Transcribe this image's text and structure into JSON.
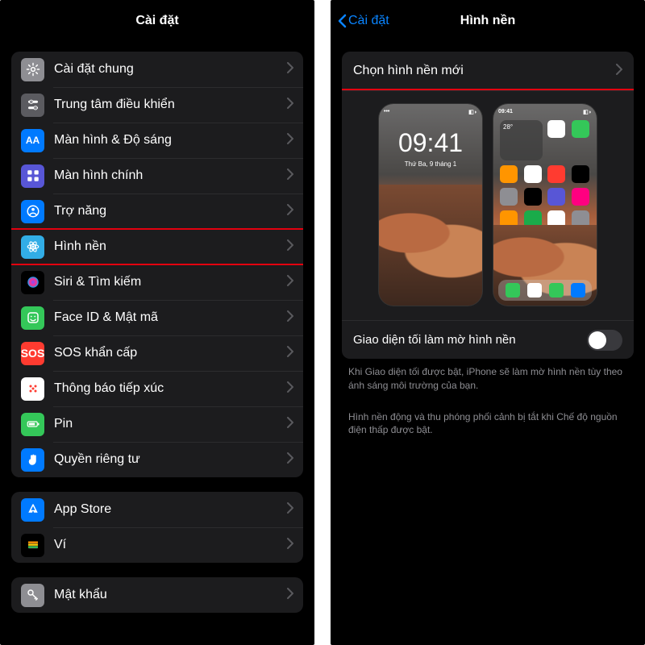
{
  "left": {
    "title": "Cài đặt",
    "groups": [
      [
        {
          "key": "general",
          "label": "Cài đặt chung",
          "iconClass": "bg-gray",
          "glyph": "gear"
        },
        {
          "key": "control",
          "label": "Trung tâm điều khiển",
          "iconClass": "bg-graydark",
          "glyph": "sliders"
        },
        {
          "key": "display",
          "label": "Màn hình & Độ sáng",
          "iconClass": "bg-blue",
          "glyph": "AA",
          "textIcon": true
        },
        {
          "key": "home",
          "label": "Màn hình chính",
          "iconClass": "bg-purple",
          "glyph": "grid"
        },
        {
          "key": "accessibility",
          "label": "Trợ năng",
          "iconClass": "bg-blue",
          "glyph": "person"
        },
        {
          "key": "wallpaper",
          "label": "Hình nền",
          "iconClass": "bg-teal",
          "glyph": "flower",
          "highlight": true
        },
        {
          "key": "siri",
          "label": "Siri & Tìm kiếm",
          "iconClass": "bg-black",
          "glyph": "siri"
        },
        {
          "key": "faceid",
          "label": "Face ID & Mật mã",
          "iconClass": "bg-green",
          "glyph": "face"
        },
        {
          "key": "sos",
          "label": "SOS khẩn cấp",
          "iconClass": "bg-red",
          "glyph": "SOS",
          "textIcon": true,
          "sos": true
        },
        {
          "key": "exposure",
          "label": "Thông báo tiếp xúc",
          "iconClass": "bg-white",
          "glyph": "exposure"
        },
        {
          "key": "battery",
          "label": "Pin",
          "iconClass": "bg-green",
          "glyph": "battery"
        },
        {
          "key": "privacy",
          "label": "Quyền riêng tư",
          "iconClass": "bg-blue",
          "glyph": "hand"
        }
      ],
      [
        {
          "key": "appstore",
          "label": "App Store",
          "iconClass": "bg-blue",
          "glyph": "appstore"
        },
        {
          "key": "wallet",
          "label": "Ví",
          "iconClass": "bg-black",
          "glyph": "wallet"
        }
      ],
      [
        {
          "key": "passwords",
          "label": "Mật khẩu",
          "iconClass": "bg-gray",
          "glyph": "key"
        }
      ]
    ]
  },
  "right": {
    "back": "Cài đặt",
    "title": "Hình nền",
    "choose": "Chọn hình nền mới",
    "dimLabel": "Giao diện tối làm mờ hình nền",
    "dimOn": false,
    "note1": "Khi Giao diện tối được bật, iPhone sẽ làm mờ hình nền tùy theo ánh sáng môi trường của bạn.",
    "note2": "Hình nền động và thu phóng phối cảnh bị tắt khi Chế độ nguồn điện thấp được bật.",
    "lockTime": "09:41",
    "lockDate": "Thứ Ba, 9 tháng 1",
    "homeStatus": "09:41"
  }
}
